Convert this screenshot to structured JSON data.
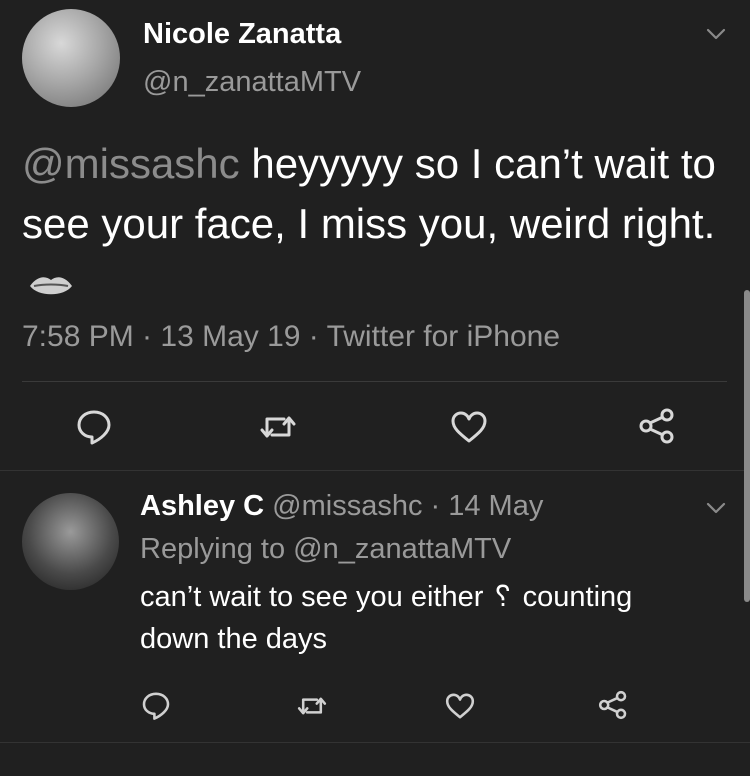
{
  "main_tweet": {
    "display_name": "Nicole Zanatta",
    "handle": "@n_zanattaMTV",
    "mention": "@missashc",
    "text": " heyyyyy so I can’t wait to see your face, I miss you, weird right.",
    "emoji_icon": "lips-icon",
    "meta": "7:58 PM · 13 May 19 · Twitter for iPhone",
    "actions": [
      "reply-icon",
      "retweet-icon",
      "like-icon",
      "share-icon"
    ]
  },
  "reply_tweet": {
    "display_name": "Ashley C",
    "handle": "@missashc",
    "time": "· 14 May",
    "replying_to": "Replying to @n_zanattaMTV",
    "text": "can’t wait to see you either ␦ counting down the days",
    "actions": [
      "reply-icon",
      "retweet-icon",
      "like-icon",
      "share-icon"
    ]
  }
}
